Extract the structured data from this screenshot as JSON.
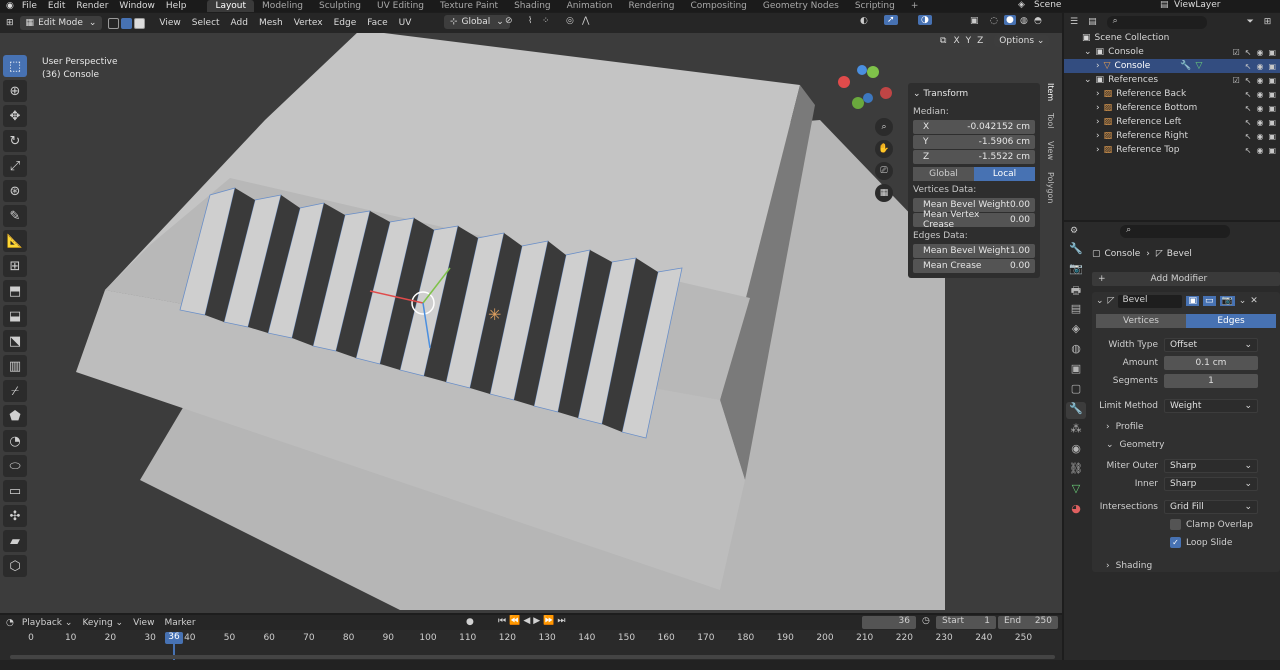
{
  "topbar": {
    "menus": [
      "File",
      "Edit",
      "Render",
      "Window",
      "Help"
    ],
    "tabs": [
      "Layout",
      "Modeling",
      "Sculpting",
      "UV Editing",
      "Texture Paint",
      "Shading",
      "Animation",
      "Rendering",
      "Compositing",
      "Geometry Nodes",
      "Scripting"
    ],
    "active_tab": "Layout",
    "scene": "Scene",
    "view_layer": "ViewLayer"
  },
  "viewport_header": {
    "mode": "Edit Mode",
    "menus": [
      "View",
      "Select",
      "Add",
      "Mesh",
      "Vertex",
      "Edge",
      "Face",
      "UV"
    ],
    "orientation": "Global",
    "options": "Options",
    "axis_x": "X",
    "axis_y": "Y",
    "axis_z": "Z"
  },
  "viewport": {
    "perspective": "User Perspective",
    "object_info": "(36) Console"
  },
  "npanel": {
    "title": "Transform",
    "median_label": "Median:",
    "x_label": "X",
    "x_value": "-0.042152 cm",
    "y_label": "Y",
    "y_value": "-1.5906 cm",
    "z_label": "Z",
    "z_value": "-1.5522 cm",
    "global": "Global",
    "local": "Local",
    "vertices_data": "Vertices Data:",
    "mean_bevel_weight_label": "Mean Bevel Weight",
    "mean_bevel_weight_v": "0.00",
    "mean_vertex_crease_label": "Mean Vertex Crease",
    "mean_vertex_crease_v": "0.00",
    "edges_data": "Edges Data:",
    "mean_bevel_weight_e": "1.00",
    "mean_crease_label": "Mean Crease",
    "mean_crease_e": "0.00",
    "tabs": [
      "Item",
      "Tool",
      "View",
      "Polygon"
    ]
  },
  "outliner": {
    "scene_collection": "Scene Collection",
    "rows": [
      {
        "label": "Console",
        "indent": 1
      },
      {
        "label": "Console",
        "indent": 2
      },
      {
        "label": "References",
        "indent": 1
      },
      {
        "label": "Reference Back",
        "indent": 2
      },
      {
        "label": "Reference Bottom",
        "indent": 2
      },
      {
        "label": "Reference Left",
        "indent": 2
      },
      {
        "label": "Reference Right",
        "indent": 2
      },
      {
        "label": "Reference Top",
        "indent": 2
      }
    ]
  },
  "properties": {
    "breadcrumb_object": "Console",
    "breadcrumb_modifier": "Bevel",
    "add_modifier": "Add Modifier",
    "modifier_name": "Bevel",
    "seg_vertices": "Vertices",
    "seg_edges": "Edges",
    "width_type_label": "Width Type",
    "width_type": "Offset",
    "amount_label": "Amount",
    "amount": "0.1 cm",
    "segments_label": "Segments",
    "segments": "1",
    "limit_method_label": "Limit Method",
    "limit_method": "Weight",
    "profile": "Profile",
    "geometry": "Geometry",
    "miter_outer_label": "Miter Outer",
    "miter_outer": "Sharp",
    "inner_label": "Inner",
    "inner": "Sharp",
    "intersections_label": "Intersections",
    "intersections": "Grid Fill",
    "clamp_overlap": "Clamp Overlap",
    "loop_slide": "Loop Slide",
    "shading": "Shading"
  },
  "timeline": {
    "menus": [
      "Playback",
      "Keying",
      "View",
      "Marker"
    ],
    "current_frame": "36",
    "start_label": "Start",
    "start": "1",
    "end_label": "End",
    "end": "250",
    "ticks": [
      "0",
      "10",
      "20",
      "30",
      "40",
      "50",
      "60",
      "70",
      "80",
      "90",
      "100",
      "110",
      "120",
      "130",
      "140",
      "150",
      "160",
      "170",
      "180",
      "190",
      "200",
      "210",
      "220",
      "230",
      "240",
      "250"
    ]
  },
  "colors": {
    "accent": "#4772b3",
    "viewport_bg": "#3c3c3c",
    "panel_bg": "#2e2e2e"
  }
}
